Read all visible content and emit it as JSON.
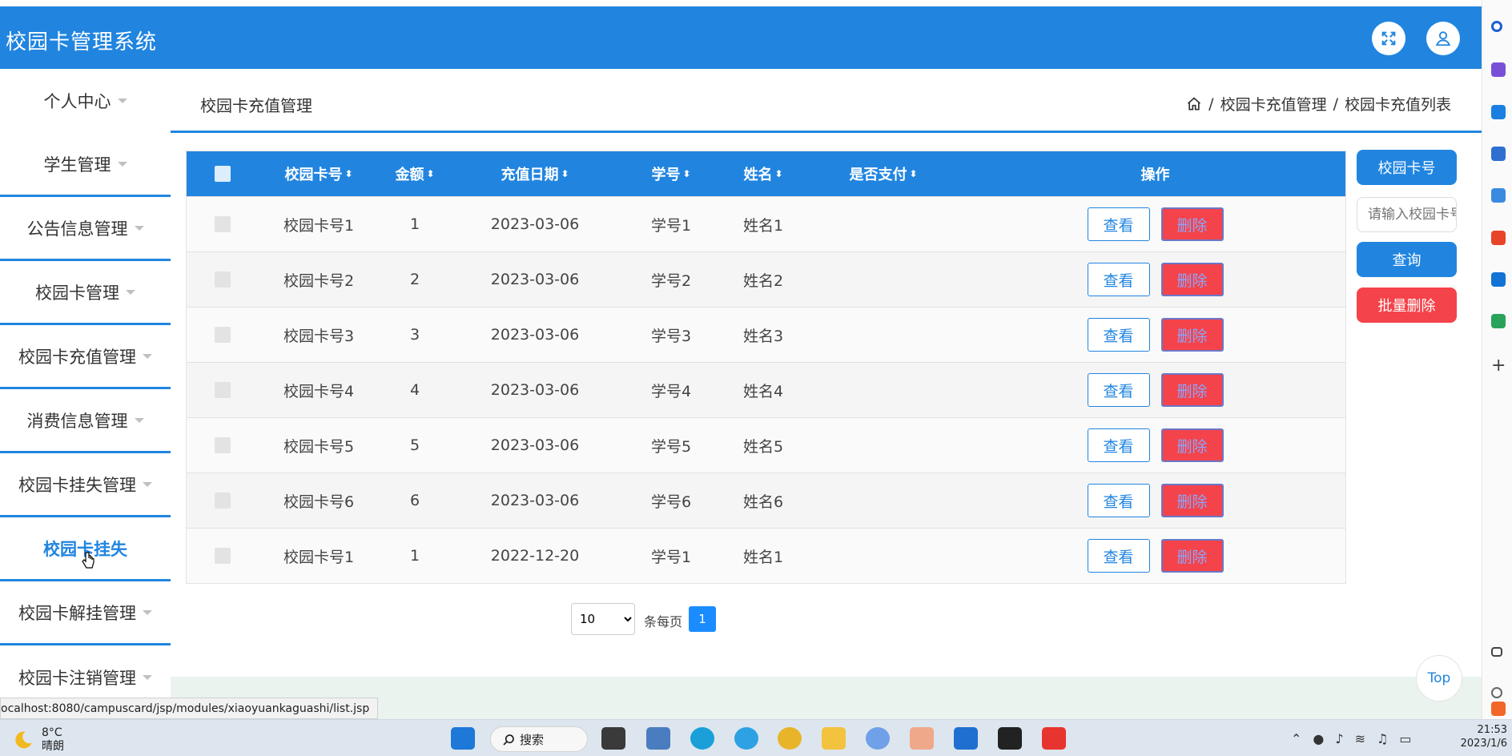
{
  "header": {
    "app_title": "校园卡管理系统",
    "expand_icon": "fullscreen-icon",
    "user_icon": "user-icon",
    "color": "#2185e0"
  },
  "sidebar": {
    "items": [
      {
        "label": "个人中心"
      },
      {
        "label": "学生管理"
      },
      {
        "label": "公告信息管理"
      },
      {
        "label": "校园卡管理"
      },
      {
        "label": "校园卡充值管理"
      },
      {
        "label": "消费信息管理"
      },
      {
        "label": "校园卡挂失管理"
      },
      {
        "label": "校园卡挂失",
        "active": true
      },
      {
        "label": "校园卡解挂管理"
      },
      {
        "label": "校园卡注销管理"
      }
    ]
  },
  "content": {
    "page_title": "校园卡充值管理",
    "breadcrumb": [
      "校园卡充值管理",
      "校园卡充值列表"
    ],
    "sep": "/"
  },
  "table": {
    "columns": {
      "card": "校园卡号",
      "amount": "金额",
      "date": "充值日期",
      "sno": "学号",
      "name": "姓名",
      "paid": "是否支付",
      "ops": "操作"
    },
    "view_label": "查看",
    "delete_label": "删除",
    "rows": [
      {
        "card": "校园卡号1",
        "amount": "1",
        "date": "2023-03-06",
        "sno": "学号1",
        "name": "姓名1",
        "paid": ""
      },
      {
        "card": "校园卡号2",
        "amount": "2",
        "date": "2023-03-06",
        "sno": "学号2",
        "name": "姓名2",
        "paid": ""
      },
      {
        "card": "校园卡号3",
        "amount": "3",
        "date": "2023-03-06",
        "sno": "学号3",
        "name": "姓名3",
        "paid": ""
      },
      {
        "card": "校园卡号4",
        "amount": "4",
        "date": "2023-03-06",
        "sno": "学号4",
        "name": "姓名4",
        "paid": ""
      },
      {
        "card": "校园卡号5",
        "amount": "5",
        "date": "2023-03-06",
        "sno": "学号5",
        "name": "姓名5",
        "paid": ""
      },
      {
        "card": "校园卡号6",
        "amount": "6",
        "date": "2023-03-06",
        "sno": "学号6",
        "name": "姓名6",
        "paid": ""
      },
      {
        "card": "校园卡号1",
        "amount": "1",
        "date": "2022-12-20",
        "sno": "学号1",
        "name": "姓名1",
        "paid": ""
      }
    ]
  },
  "actions": {
    "field_label": "校园卡号",
    "search_placeholder": "请输入校园卡号",
    "query_label": "查询",
    "batch_delete_label": "批量删除"
  },
  "pagination": {
    "page_size": "10",
    "per_page_label": "条每页",
    "current_page": "1"
  },
  "top_button": "Top",
  "status_url": "ocalhost:8080/campuscard/jsp/modules/xiaoyuankaguashi/list.jsp",
  "taskbar": {
    "weather_temp": "8°C",
    "weather_desc": "晴朗",
    "search_label": "搜索",
    "time": "21:53",
    "date": "2023/1/6"
  }
}
